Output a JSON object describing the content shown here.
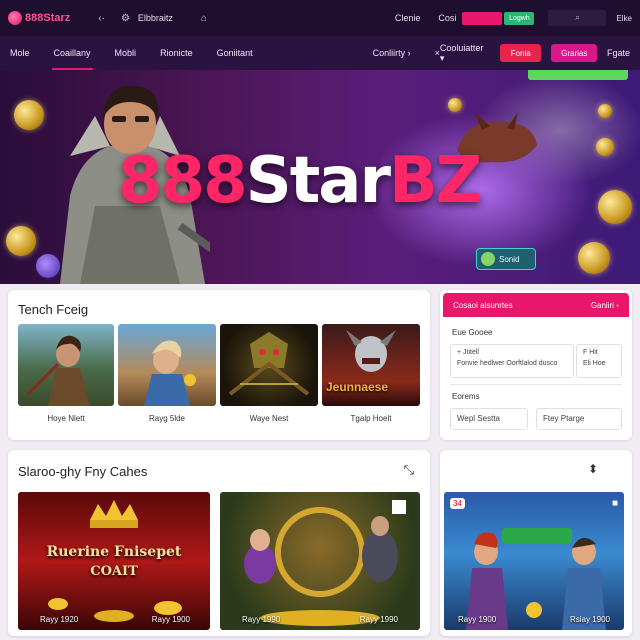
{
  "topbar": {
    "brand": "888Starz",
    "icon_1": "‹·",
    "icon_2": "⚙",
    "link_1": "Elbbraitz",
    "icon_3": "⌂",
    "right_link": "Clenie",
    "label": "Cosi",
    "pink_button": "",
    "green_button": "Logwh",
    "search_icon": "⌕",
    "search_label": "",
    "mini": "Elke"
  },
  "nav": {
    "items": [
      "Mole",
      "Coaillany",
      "Mobli",
      "Rionicte",
      "Goniitant"
    ],
    "active_index": 1,
    "dropdown": "Conliirty",
    "dropdown_arrow": "›",
    "x_mark": "×",
    "right_dropdown": "Cooluiatter",
    "right_arrow": "▾",
    "btn_red": "Fonia",
    "btn_pink": "Grarias",
    "right_link": "Fgate"
  },
  "hero": {
    "title_num": "888",
    "title_mid": "Star",
    "title_end": "BZ",
    "badge_label": "Sonid",
    "colors": {
      "accent": "#ff2668",
      "promo": "#5dd85d"
    }
  },
  "top_games": {
    "title": "Tench Fceig",
    "games": [
      {
        "caption": "Hoye Nlett"
      },
      {
        "caption": "Rayg 5lde"
      },
      {
        "caption": "Waye Nest"
      },
      {
        "caption": "Tgalp Hoelt"
      }
    ],
    "tile_text_4": "Jeunnaese"
  },
  "sidebar": {
    "header_left": "Cosaoi alsunrtes",
    "header_right": "Ganiiri ◦",
    "section_1": "Eue Gooee",
    "box_1_line_1": "+ Jtitell",
    "box_1_line_2": "Fonvie hedlwer Oorftlalod dusco",
    "box_2_line_1": "F Hit",
    "box_2_line_2": "Eli Hoe",
    "section_2": "Eorems",
    "btn_left": "Wepl Sestta",
    "btn_right": "Ftey Ptarge"
  },
  "recommended": {
    "title": "Slaroo-ghy Fny Cahes",
    "action_icon": "⤡",
    "tiles": [
      {
        "caption_left": "Rayy 1920",
        "caption_right": "Rayy 1900",
        "banner_line_1": "Ruerine Fnisepet",
        "banner_line_2": "COAIT"
      },
      {
        "caption_left": "Rayy 1990",
        "caption_right": "Rayy 1990"
      }
    ]
  },
  "side_game": {
    "icon": "⬍",
    "corner_icon": "■",
    "caption_left": "Rayy 1900",
    "caption_right": "Rsiay 1900",
    "badge": "34"
  }
}
